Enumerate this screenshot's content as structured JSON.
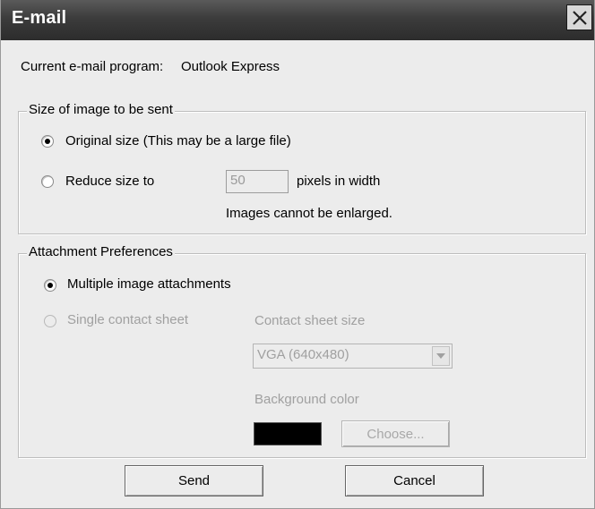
{
  "window": {
    "title": "E-mail"
  },
  "current_program": {
    "label": "Current e-mail program:",
    "value": "Outlook Express"
  },
  "size_group": {
    "legend": "Size of image to be sent",
    "original_label": "Original size (This may be a large file)",
    "original_selected": true,
    "reduce_label": "Reduce size to",
    "reduce_selected": false,
    "pixels_value": "50",
    "pixels_suffix": "pixels in width",
    "note": "Images cannot be enlarged."
  },
  "attachment_group": {
    "legend": "Attachment Preferences",
    "multiple_label": "Multiple image attachments",
    "multiple_selected": true,
    "single_label": "Single contact sheet",
    "single_selected": false,
    "contact_sheet_size_label": "Contact sheet size",
    "contact_sheet_size_value": "VGA (640x480)",
    "background_color_label": "Background color",
    "background_color": "#000000",
    "choose_label": "Choose..."
  },
  "buttons": {
    "send": "Send",
    "cancel": "Cancel"
  }
}
